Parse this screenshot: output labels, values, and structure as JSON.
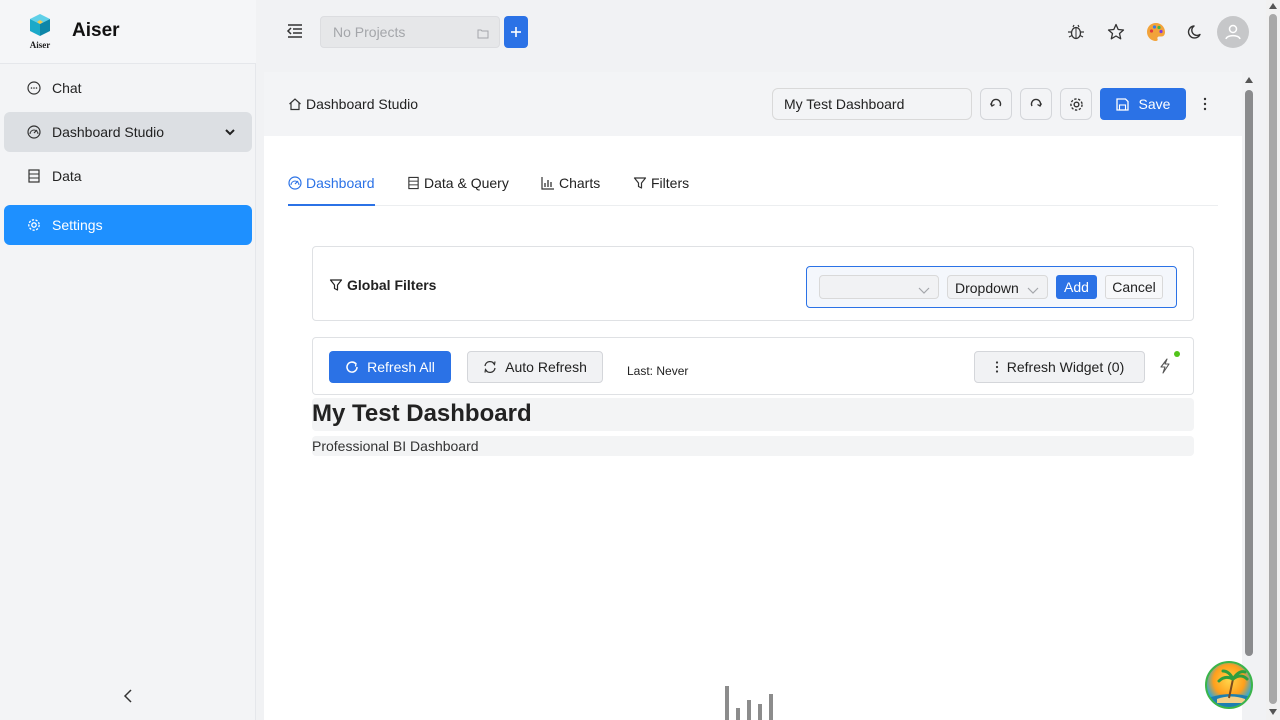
{
  "brand": {
    "name": "Aiser",
    "logo_text": "Aiser",
    "logo_icon": "cube-logo-icon"
  },
  "sidebar": {
    "items": [
      {
        "label": "Chat",
        "icon": "chat-bubble-icon"
      },
      {
        "label": "Dashboard Studio",
        "icon": "dashboard-gauge-icon"
      },
      {
        "label": "Data",
        "icon": "database-icon"
      },
      {
        "label": "Settings",
        "icon": "gear-icon"
      }
    ],
    "selected": "Dashboard Studio",
    "active": "Settings"
  },
  "topbar": {
    "project_placeholder": "No Projects",
    "icons": [
      "menu-fold-icon",
      "folder-icon",
      "plus-icon",
      "bug-icon",
      "star-icon",
      "palette-icon",
      "moon-icon",
      "user-avatar-icon"
    ]
  },
  "header": {
    "breadcrumb": "Dashboard Studio",
    "dashboard_name": "My Test Dashboard",
    "save_label": "Save"
  },
  "tabs": [
    {
      "label": "Dashboard",
      "icon": "dashboard-icon",
      "active": true
    },
    {
      "label": "Data & Query",
      "icon": "database-icon",
      "active": false
    },
    {
      "label": "Charts",
      "icon": "bar-chart-icon",
      "active": false
    },
    {
      "label": "Filters",
      "icon": "filter-icon",
      "active": false
    }
  ],
  "filters": {
    "title": "Global Filters",
    "field_value": "",
    "type_value": "Dropdown",
    "add_label": "Add",
    "cancel_label": "Cancel"
  },
  "toolbar": {
    "refresh_all": "Refresh All",
    "auto_refresh": "Auto Refresh",
    "last_refresh": "Last: Never",
    "refresh_widget": "Refresh Widget (0)",
    "status_color": "#52c41a"
  },
  "dashboard": {
    "title": "My Test Dashboard",
    "subtitle": "Professional BI Dashboard"
  },
  "colors": {
    "primary": "#2b72e6",
    "sidebar_active": "#1e90ff"
  }
}
